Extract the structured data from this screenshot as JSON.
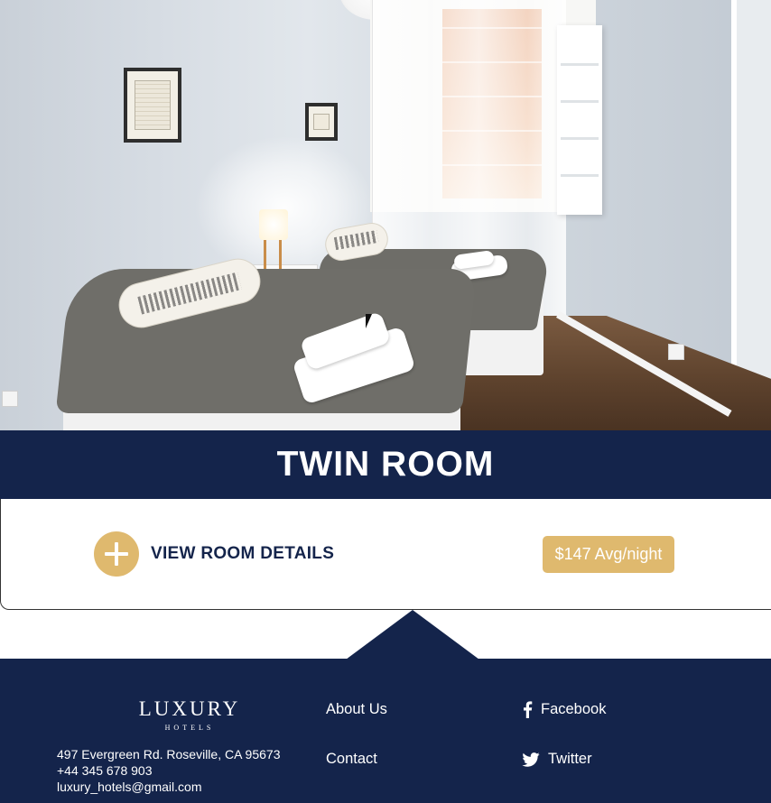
{
  "room": {
    "title": "TWIN ROOM",
    "details_label": "VIEW ROOM DETAILS",
    "price": "$147 Avg/night"
  },
  "footer": {
    "logo": {
      "main": "LUXURY",
      "sub": "HOTELS"
    },
    "address_lines": [
      "497 Evergreen Rd. Roseville, CA 95673",
      "+44 345 678 903",
      "luxury_hotels@gmail.com"
    ],
    "links": {
      "about": "About Us",
      "contact": "Contact"
    },
    "social": {
      "facebook": "Facebook",
      "twitter": "Twitter"
    }
  },
  "colors": {
    "navy": "#14244b",
    "gold": "#dfb96e",
    "white": "#ffffff"
  },
  "icons": [
    "plus-icon",
    "facebook-icon",
    "twitter-icon",
    "mouse-cursor-icon"
  ]
}
